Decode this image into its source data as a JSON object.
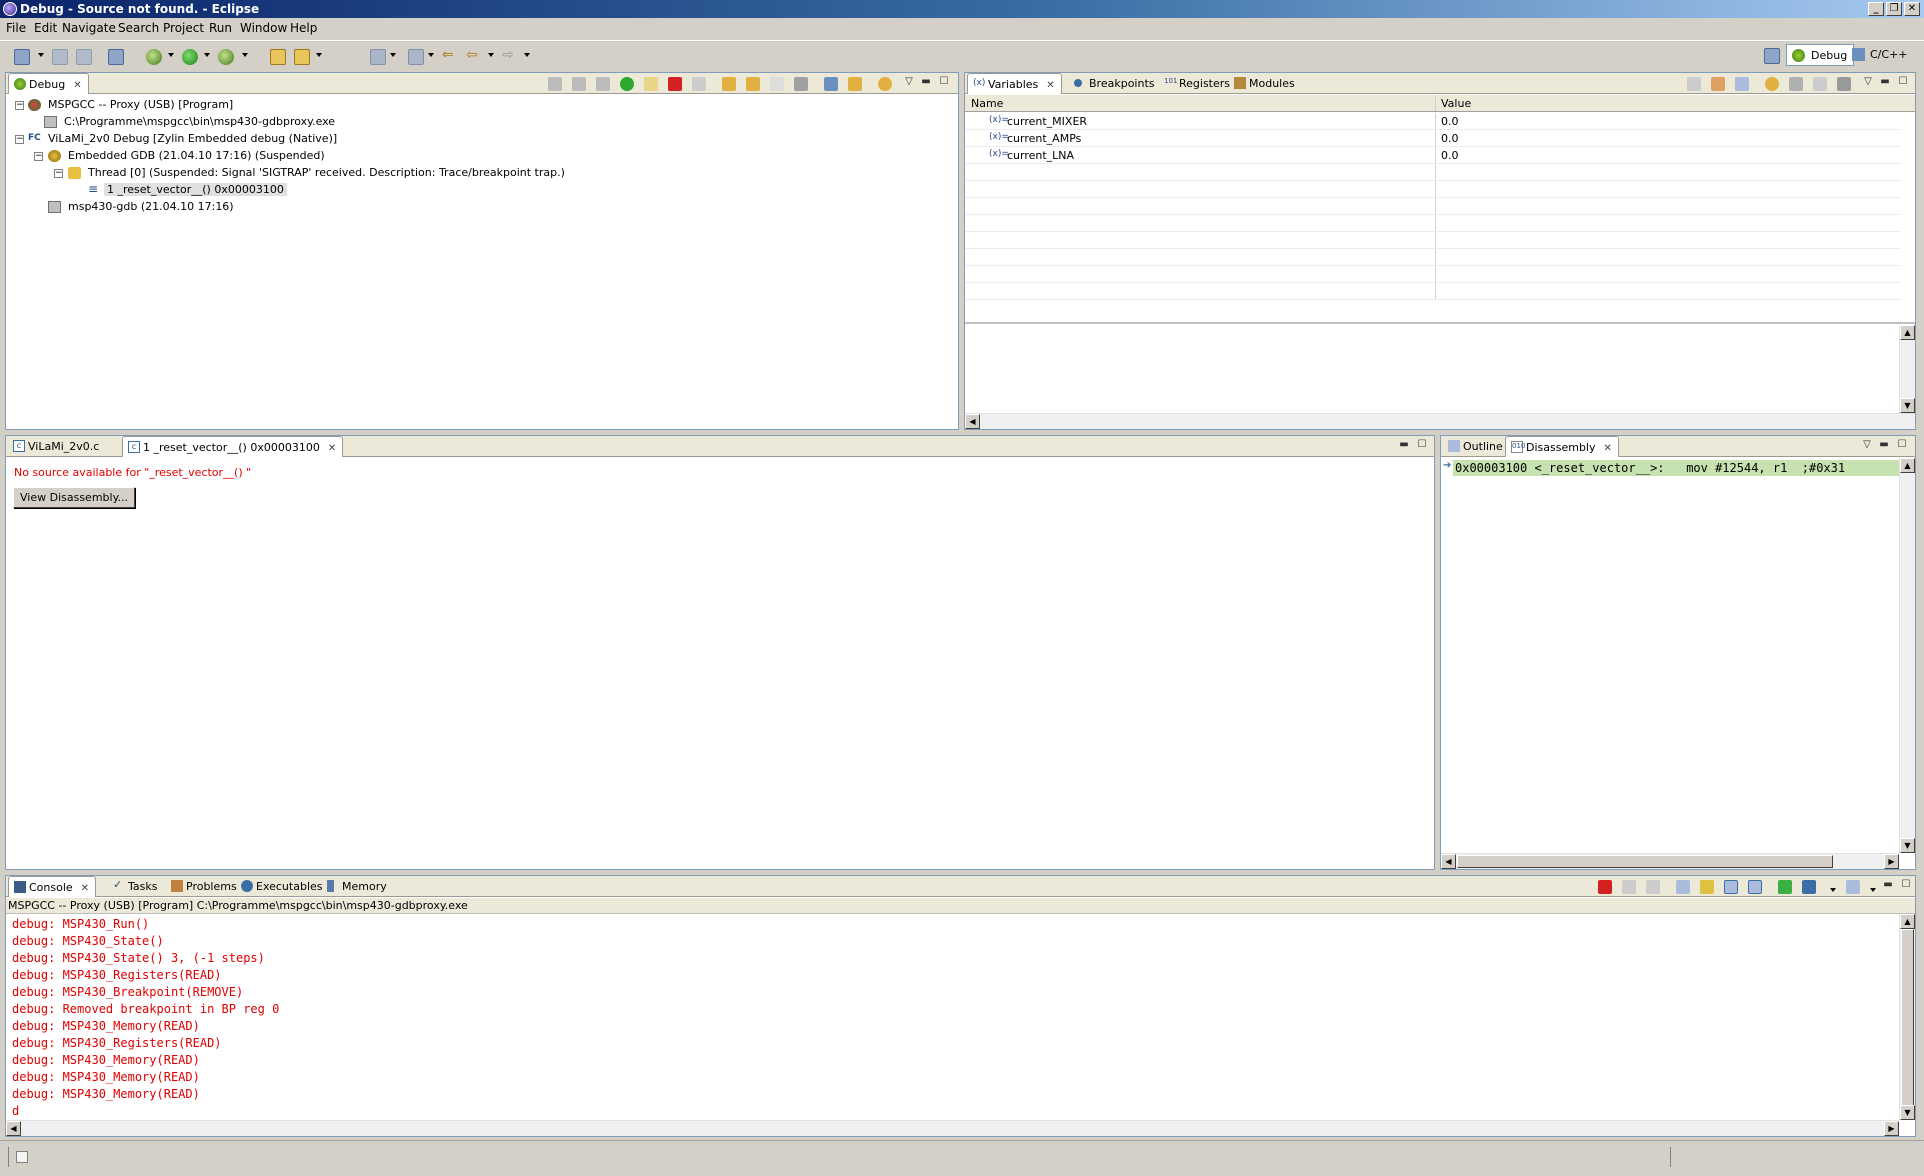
{
  "window": {
    "title": "Debug - Source not found. - Eclipse",
    "controls": [
      "_",
      "❐",
      "✕"
    ]
  },
  "menu": [
    "File",
    "Edit",
    "Navigate",
    "Search",
    "Project",
    "Run",
    "Window",
    "Help"
  ],
  "perspectives": [
    {
      "label": "Debug",
      "active": true
    },
    {
      "label": "C/C++",
      "active": false
    }
  ],
  "debug_view": {
    "tab": "Debug",
    "tree": [
      "MSPGCC -- Proxy (USB) [Program]",
      "C:\\Programme\\mspgcc\\bin\\msp430-gdbproxy.exe",
      "ViLaMi_2v0 Debug [Zylin Embedded debug (Native)]",
      "Embedded GDB (21.04.10 17:16) (Suspended)",
      "Thread [0] (Suspended: Signal 'SIGTRAP' received. Description: Trace/breakpoint trap.)",
      "1 _reset_vector__() 0x00003100",
      "msp430-gdb (21.04.10 17:16)"
    ]
  },
  "variables_view": {
    "tabs": [
      "Variables",
      "Breakpoints",
      "Registers",
      "Modules"
    ],
    "columns": [
      "Name",
      "Value"
    ],
    "rows": [
      {
        "name": "current_MIXER",
        "value": "0.0"
      },
      {
        "name": "current_AMPs",
        "value": "0.0"
      },
      {
        "name": "current_LNA",
        "value": "0.0"
      }
    ]
  },
  "editor": {
    "tabs": [
      "ViLaMi_2v0.c",
      "1 _reset_vector__() 0x00003100"
    ],
    "message": "No source available for \"_reset_vector__() \"",
    "button": "View Disassembly..."
  },
  "disassembly_view": {
    "tabs": [
      "Outline",
      "Disassembly"
    ],
    "line": "0x00003100 <_reset_vector__>:   mov #12544, r1  ;#0x31"
  },
  "console_view": {
    "tabs": [
      "Console",
      "Tasks",
      "Problems",
      "Executables",
      "Memory"
    ],
    "header": "MSPGCC -- Proxy (USB) [Program] C:\\Programme\\mspgcc\\bin\\msp430-gdbproxy.exe",
    "lines": [
      "debug: MSP430_Run()",
      "debug: MSP430_State()",
      "debug: MSP430_State() 3, (-1 steps)",
      "debug: MSP430_Registers(READ)",
      "debug: MSP430_Breakpoint(REMOVE)",
      "debug: Removed breakpoint in BP reg 0",
      "debug: MSP430_Memory(READ)",
      "debug: MSP430_Registers(READ)",
      "debug: MSP430_Memory(READ)",
      "debug: MSP430_Memory(READ)",
      "debug: MSP430_Memory(READ)",
      "d"
    ]
  },
  "colors": {
    "titlebar": "#0a246a",
    "console_text": "#e00000",
    "error_text": "#e00000",
    "current_line": "#c6e2b0"
  }
}
